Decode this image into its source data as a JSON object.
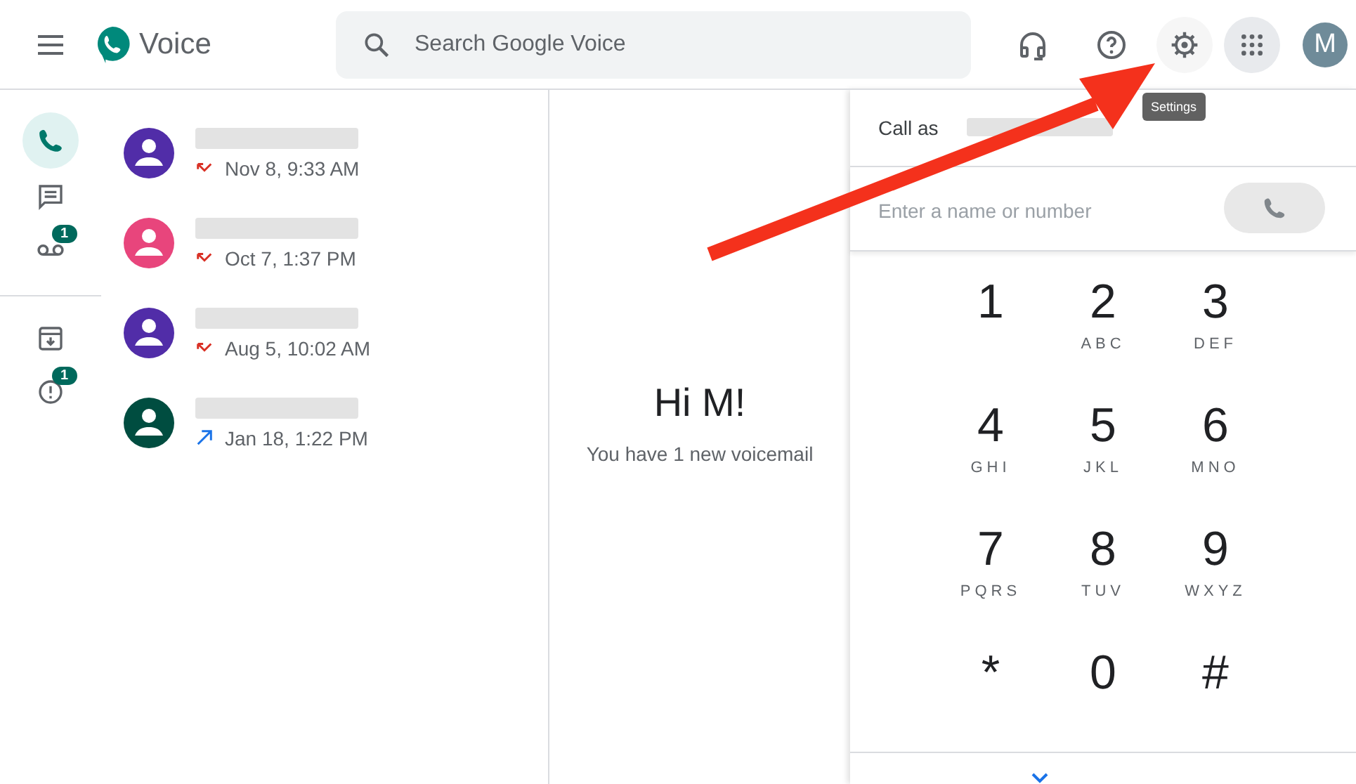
{
  "header": {
    "app_name": "Voice",
    "search": {
      "placeholder": "Search Google Voice"
    },
    "avatar_letter": "M",
    "tooltip": "Settings"
  },
  "rail": [
    {
      "selected": true
    },
    {
      "selected": false
    },
    {
      "selected": false,
      "badge": "1"
    },
    {
      "selected": false
    },
    {
      "selected": false,
      "badge": "1"
    }
  ],
  "calls": [
    {
      "color": "#512da8",
      "kind": "missed",
      "time": "Nov 8, 9:33 AM"
    },
    {
      "color": "#e8457c",
      "kind": "missed",
      "time": "Oct 7, 1:37 PM"
    },
    {
      "color": "#512da8",
      "kind": "missed",
      "time": "Aug 5, 10:02 AM"
    },
    {
      "color": "#004d40",
      "kind": "outgoing",
      "time": "Jan 18, 1:22 PM"
    }
  ],
  "welcome": {
    "title": "Hi M!",
    "subtitle": "You have 1 new voicemail"
  },
  "dialer": {
    "call_as": "Call as",
    "placeholder": "Enter a name or number",
    "keys": [
      {
        "digit": "1"
      },
      {
        "digit": "2",
        "letters": "ABC"
      },
      {
        "digit": "3",
        "letters": "DEF"
      },
      {
        "digit": "4",
        "letters": "GHI"
      },
      {
        "digit": "5",
        "letters": "JKL"
      },
      {
        "digit": "6",
        "letters": "MNO"
      },
      {
        "digit": "7",
        "letters": "PQRS"
      },
      {
        "digit": "8",
        "letters": "TUV"
      },
      {
        "digit": "9",
        "letters": "WXYZ"
      },
      {
        "digit": "*"
      },
      {
        "digit": "0"
      },
      {
        "digit": "#"
      }
    ]
  }
}
